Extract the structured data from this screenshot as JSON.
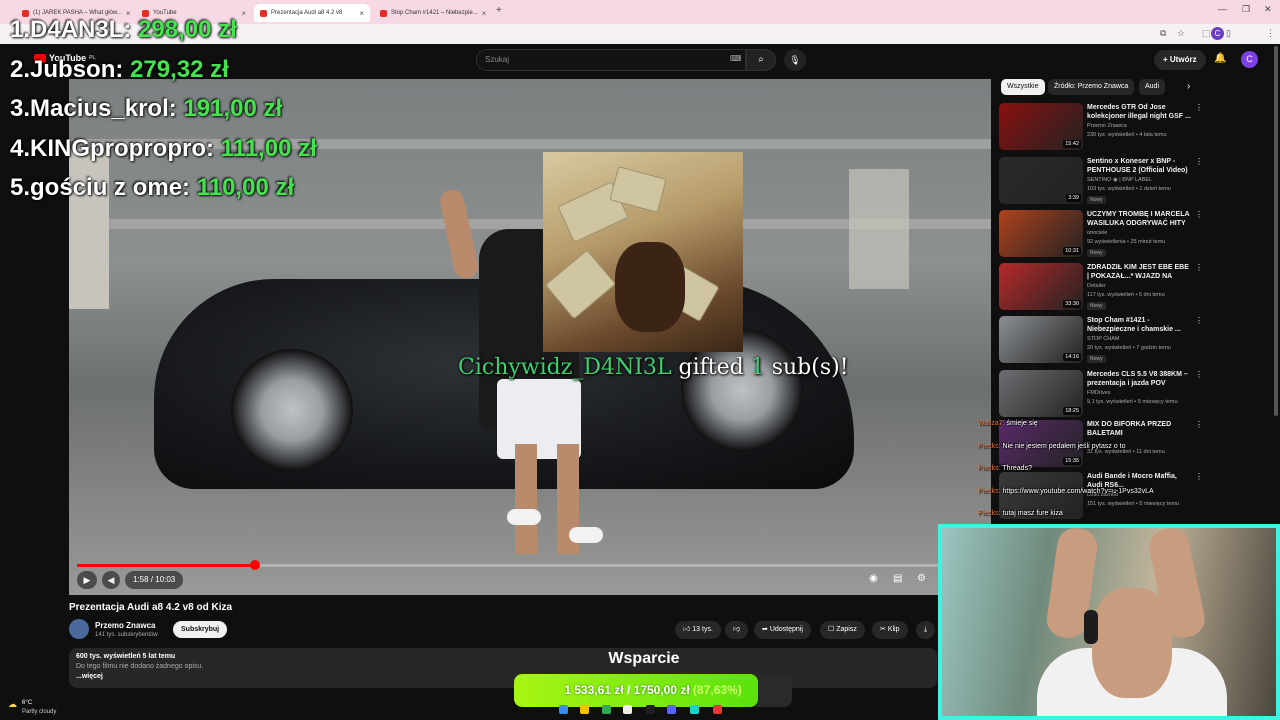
{
  "browser": {
    "tabs": [
      {
        "title": "(1) JAREK PASHA – What głów..."
      },
      {
        "title": "YouTube"
      },
      {
        "title": "Prezentacja Audi a8 4.2 v8"
      },
      {
        "title": "Stop Cham #1421 – Niebezpie..."
      }
    ]
  },
  "youtube": {
    "logo_text": "YouTube",
    "logo_suffix": "PL",
    "search_placeholder": "Szukaj",
    "create_label": "Utwórz",
    "avatar_letter": "C"
  },
  "leaderboard": [
    {
      "rank": "1.",
      "name": "D4AN3L: ",
      "amount": "298,00 zł"
    },
    {
      "rank": "2.",
      "name": "Jubson: ",
      "amount": "279,32 zł"
    },
    {
      "rank": "3.",
      "name": "Macius_krol: ",
      "amount": "191,00 zł"
    },
    {
      "rank": "4.",
      "name": "KINGpropropro: ",
      "amount": "111,00 zł"
    },
    {
      "rank": "5.",
      "name": "gościu z ome: ",
      "amount": "110,00 zł"
    }
  ],
  "alert": {
    "name": "Cichywidz_D4NI3L",
    "middle": " gifted ",
    "count": "1",
    "end": " sub(s)!"
  },
  "player": {
    "time": "1:58 / 10:03",
    "progress": 0.196
  },
  "video": {
    "title": "Prezentacja Audi a8 4.2 v8 od Kiza",
    "channel": "Przemo Znawca",
    "subscribers": "141 tys. subskrybentów",
    "subscribe_label": "Subskrybuj",
    "likes": "13 tys.",
    "share_label": "Udostępnij",
    "save_label": "Zapisz",
    "clip_label": "Klip",
    "stats": "600 tys. wyświetleń  5 lat temu",
    "description": "Do tego filmu nie dodano żadnego opisu.",
    "more_label": "...więcej"
  },
  "sidebar": {
    "chips": [
      "Wszystkie",
      "Źródło: Przemo Znawca",
      "Audi"
    ],
    "recommendations": [
      {
        "title": "Mercedes GTR Od Jose kolekcjoner illegal night GSF ...",
        "channel": "Przemo Znawca",
        "meta": "230 tys. wyświetleń • 4 lata temu",
        "duration": "15:42",
        "badge": "",
        "thumb": "#8a1010"
      },
      {
        "title": "Sentino x Koneser x BNP - PENTHOUSE 2 (Official Video)",
        "channel": "SENTINO ◉ | BNP LABEL",
        "meta": "103 tys. wyświetleń • 1 dzień temu",
        "duration": "3:39",
        "badge": "Nowy",
        "thumb": "#2a2a2a"
      },
      {
        "title": "UCZYMY TROMBĘ I MARCELA WASILUKA ODGRYWAĆ HITY ...",
        "channel": "onociele",
        "meta": "92 wyświetlenia • 25 minut temu",
        "duration": "10:31",
        "badge": "Nowy",
        "thumb": "#b0421c"
      },
      {
        "title": "ZDRADZIŁ KIM JEST EBE EBE | POKAZAŁ...* WJAZD NA GARA...",
        "channel": "Detailer",
        "meta": "117 tys. wyświetleń • 5 dni temu",
        "duration": "33:30",
        "badge": "Nowy",
        "thumb": "#b62a2a"
      },
      {
        "title": "Stop Cham #1421 - Niebezpieczne i chamskie ...",
        "channel": "STOP CHAM",
        "meta": "20 tys. wyświetleń • 7 godzin temu",
        "duration": "14:16",
        "badge": "Nowy",
        "thumb": "#8b8f93"
      },
      {
        "title": "Mercedes CLS 5.5 V8 388KM – prezentacja i jazda POV",
        "channel": "FMDrives",
        "meta": "9,1 tys. wyświetleń • 5 miesięcy temu",
        "duration": "18:25",
        "badge": "",
        "thumb": "#6d6f72"
      },
      {
        "title": "MIX DO BIFORKA PRZED BALETAMI",
        "channel": "",
        "meta": "31 tys. wyświetleń • 11 dni temu",
        "duration": "15:35",
        "badge": "",
        "thumb": "#5a2a6a"
      },
      {
        "title": "Audi Bande i Mocro Maffia, Audi RS6...",
        "channel": "Dziki zaznob",
        "meta": "151 tys. wyświetleń • 5 miesięcy temu",
        "duration": "",
        "badge": "",
        "thumb": "#3a3a3a"
      }
    ]
  },
  "chat": [
    {
      "user": "Waliza7:",
      "message": "śmieje się"
    },
    {
      "user": "Piecks:",
      "message": "Nie nie jestem pedałem jeśli pytasz o to"
    },
    {
      "user": "Piecks:",
      "message": "Threads?"
    },
    {
      "user": "Piecks:",
      "message": "https://www.youtube.com/watch?v=u-1Pvs32vLA"
    },
    {
      "user": "Piecks:",
      "message": "tutaj masz fure kiza"
    }
  ],
  "goal": {
    "title": "Wsparcie",
    "current": "1 533,61 zł",
    "separator": " / ",
    "target": "1750,00 zł",
    "percent": "(87,63%)",
    "fraction": 0.8763
  },
  "taskbar": {
    "temperature": "6°C",
    "weather": "Partly cloudy"
  },
  "colors": {
    "accent_red": "#ff0000",
    "leaderboard_amount": "#45e34e",
    "alert_name": "#3bd36f",
    "webcam_border": "#3ef3e0",
    "goal_fill": "#8cf012"
  }
}
